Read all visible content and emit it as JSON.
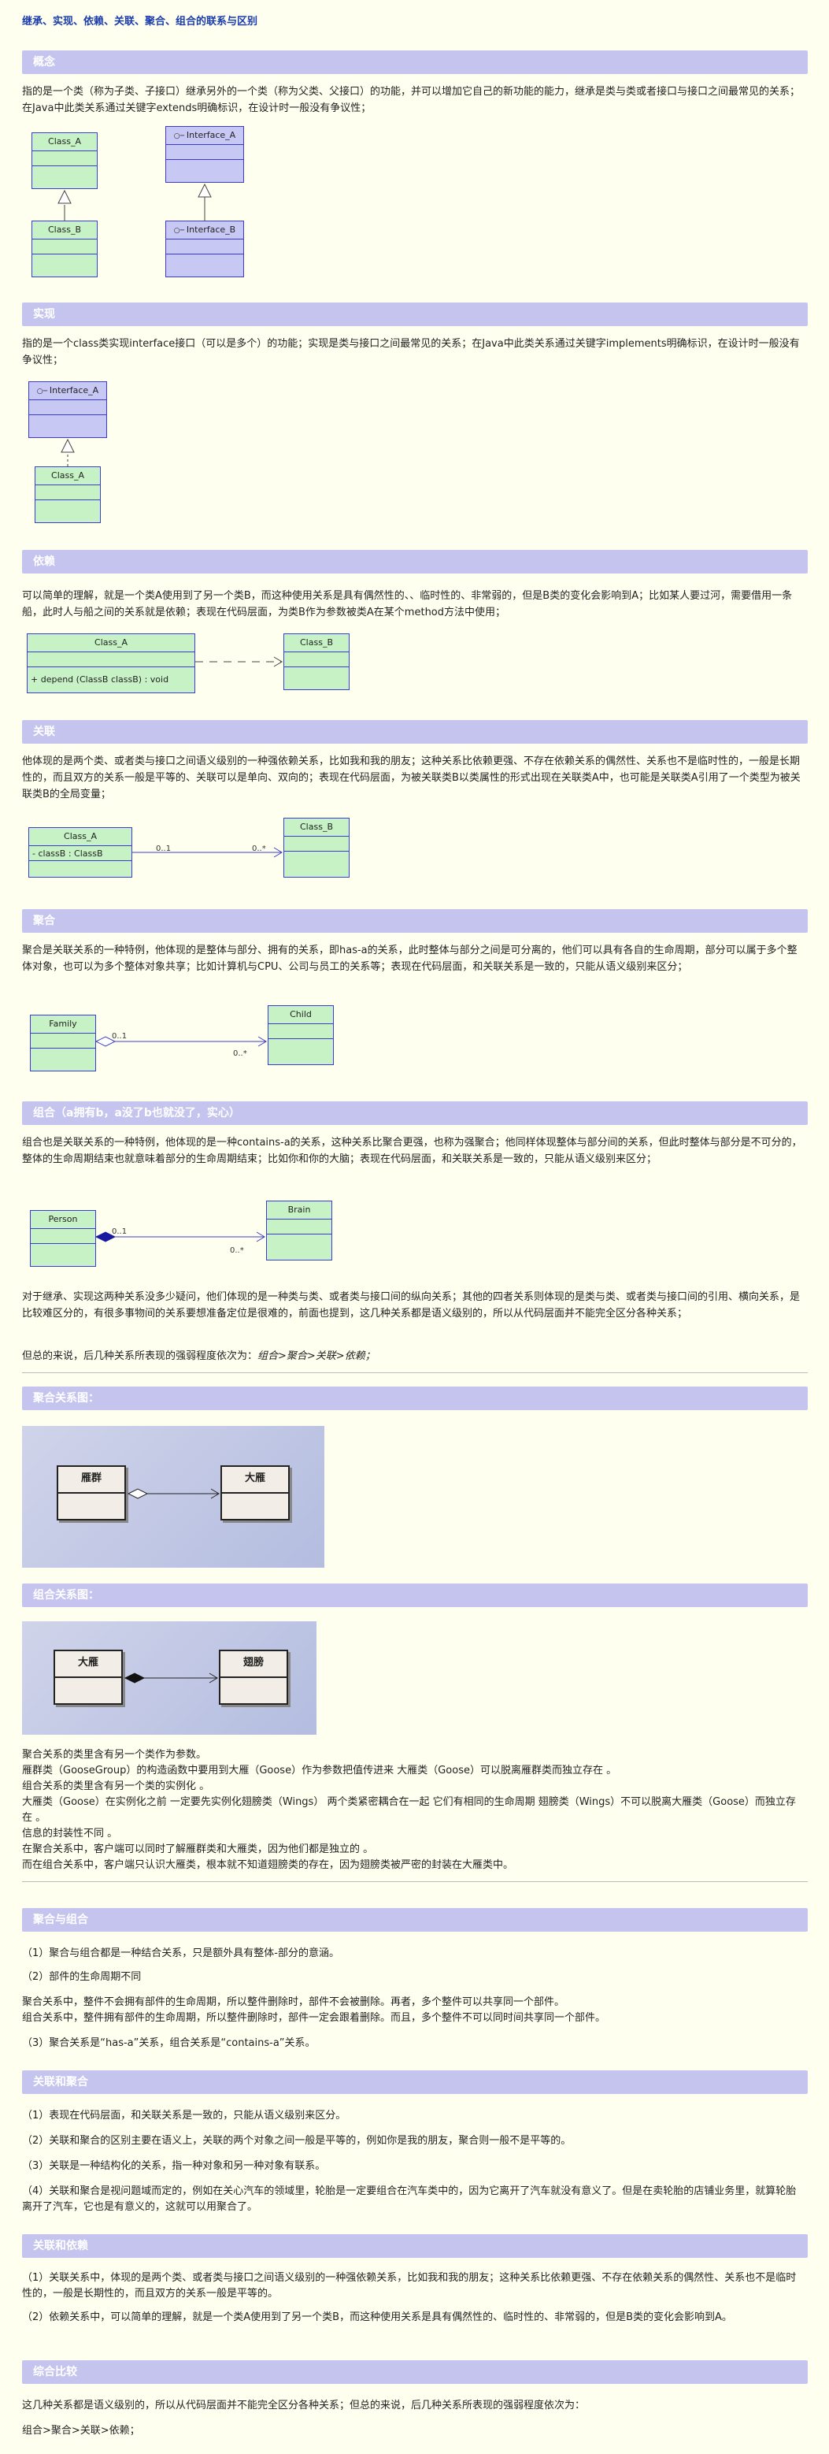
{
  "title": "继承、实现、依赖、关联、聚合、组合的联系与区别",
  "sections": {
    "inherit": {
      "heading": "概念",
      "text": "指的是一个类（称为子类、子接口）继承另外的一个类（称为父类、父接口）的功能，并可以增加它自己的新功能的能力，继承是类与类或者接口与接口之间最常见的关系；在Java中此类关系通过关键字extends明确标识，在设计时一般没有争议性；",
      "classA": "Class_A",
      "classB": "Class_B",
      "intfA": "Interface_A",
      "intfB": "Interface_B"
    },
    "impl": {
      "heading": "实现",
      "text": "指的是一个class类实现interface接口（可以是多个）的功能；实现是类与接口之间最常见的关系；在Java中此类关系通过关键字implements明确标识，在设计时一般没有争议性；",
      "intfA": "Interface_A",
      "classA": "Class_A"
    },
    "depend": {
      "heading": "依赖",
      "text": "可以简单的理解，就是一个类A使用到了另一个类B，而这种使用关系是具有偶然性的、、临时性的、非常弱的，但是B类的变化会影响到A；比如某人要过河，需要借用一条船，此时人与船之间的关系就是依赖；表现在代码层面，为类B作为参数被类A在某个method方法中使用；",
      "classA": "Class_A",
      "classB": "Class_B",
      "method": "+  depend (ClassB classB) : void"
    },
    "assoc": {
      "heading": "关联",
      "text": "他体现的是两个类、或者类与接口之间语义级别的一种强依赖关系，比如我和我的朋友；这种关系比依赖更强、不存在依赖关系的偶然性、关系也不是临时性的，一般是长期性的，而且双方的关系一般是平等的、关联可以是单向、双向的；表现在代码层面，为被关联类B以类属性的形式出现在关联类A中，也可能是关联类A引用了一个类型为被关联类B的全局变量；",
      "classA": "Class_A",
      "classB": "Class_B",
      "attr": "-  classB  : ClassB",
      "m1": "0..1",
      "m2": "0..*"
    },
    "aggr": {
      "heading": "聚合",
      "text": "聚合是关联关系的一种特例，他体现的是整体与部分、拥有的关系，即has-a的关系，此时整体与部分之间是可分离的，他们可以具有各自的生命周期，部分可以属于多个整体对象，也可以为多个整体对象共享；比如计算机与CPU、公司与员工的关系等；表现在代码层面，和关联关系是一致的，只能从语义级别来区分；",
      "whole": "Family",
      "part": "Child",
      "m1": "0..1",
      "m2": "0..*"
    },
    "comp": {
      "heading": "组合（a拥有b，a没了b也就没了，实心）",
      "text": "组合也是关联关系的一种特例，他体现的是一种contains-a的关系，这种关系比聚合更强，也称为强聚合；他同样体现整体与部分间的关系，但此时整体与部分是不可分的，整体的生命周期结束也就意味着部分的生命周期结束；比如你和你的大脑；表现在代码层面，和关联关系是一致的，只能从语义级别来区分；",
      "whole": "Person",
      "part": "Brain",
      "m1": "0..1",
      "m2": "0..*"
    },
    "summary1": "对于继承、实现这两种关系没多少疑问，他们体现的是一种类与类、或者类与接口间的纵向关系；其他的四者关系则体现的是类与类、或者类与接口间的引用、横向关系，是比较难区分的，有很多事物间的关系要想准备定位是很难的，前面也提到，这几种关系都是语义级别的，所以从代码层面并不能完全区分各种关系；",
    "summary2_prefix": "但总的来说，后几种关系所表现的强弱程度依次为：",
    "summary2_em": "组合>聚合>关联>依赖；",
    "aggrDiagram": {
      "heading": "聚合关系图：",
      "left": "雁群",
      "right": "大雁"
    },
    "compDiagram": {
      "heading": "组合关系图：",
      "left": "大雁",
      "right": "翅膀"
    },
    "explain": [
      "聚合关系的类里含有另一个类作为参数。",
      "雁群类（GooseGroup）的构造函数中要用到大雁（Goose）作为参数把值传进来 大雁类（Goose）可以脱离雁群类而独立存在 。",
      "组合关系的类里含有另一个类的实例化 。",
      "大雁类（Goose）在实例化之前 一定要先实例化翅膀类（Wings） 两个类紧密耦合在一起 它们有相同的生命周期 翅膀类（Wings）不可以脱离大雁类（Goose）而独立存在 。",
      "信息的封装性不同 。",
      "在聚合关系中，客户端可以同时了解雁群类和大雁类，因为他们都是独立的 。",
      "而在组合关系中，客户端只认识大雁类，根本就不知道翅膀类的存在，因为翅膀类被严密的封装在大雁类中。"
    ],
    "aggrVsComp": {
      "heading": "聚合与组合",
      "lines": [
        "（1）聚合与组合都是一种结合关系，只是额外具有整体-部分的意涵。",
        "（2）部件的生命周期不同",
        "聚合关系中，整件不会拥有部件的生命周期，所以整件删除时，部件不会被删除。再者，多个整件可以共享同一个部件。",
        "组合关系中，整件拥有部件的生命周期，所以整件删除时，部件一定会跟着删除。而且，多个整件不可以同时间共享同一个部件。",
        "（3）聚合关系是“has-a”关系，组合关系是“contains-a”关系。"
      ]
    },
    "assocVsAggr": {
      "heading": "关联和聚合",
      "lines": [
        "（1）表现在代码层面，和关联关系是一致的，只能从语义级别来区分。",
        "（2）关联和聚合的区别主要在语义上，关联的两个对象之间一般是平等的，例如你是我的朋友，聚合则一般不是平等的。",
        "（3）关联是一种结构化的关系，指一种对象和另一种对象有联系。",
        "（4）关联和聚合是视问题域而定的，例如在关心汽车的领域里，轮胎是一定要组合在汽车类中的，因为它离开了汽车就没有意义了。但是在卖轮胎的店铺业务里，就算轮胎离开了汽车，它也是有意义的，这就可以用聚合了。"
      ]
    },
    "assocVsDep": {
      "heading": "关联和依赖",
      "lines": [
        "（1）关联关系中，体现的是两个类、或者类与接口之间语义级别的一种强依赖关系，比如我和我的朋友；这种关系比依赖更强、不存在依赖关系的偶然性、关系也不是临时性的，一般是长期性的，而且双方的关系一般是平等的。",
        "（2）依赖关系中，可以简单的理解，就是一个类A使用到了另一个类B，而这种使用关系是具有偶然性的、临时性的、非常弱的，但是B类的变化会影响到A。"
      ]
    },
    "overall": {
      "heading": "综合比较",
      "text": "这几种关系都是语义级别的，所以从代码层面并不能完全区分各种关系；但总的来说，后几种关系所表现的强弱程度依次为：",
      "order": "组合>聚合>关联>依赖；"
    }
  }
}
